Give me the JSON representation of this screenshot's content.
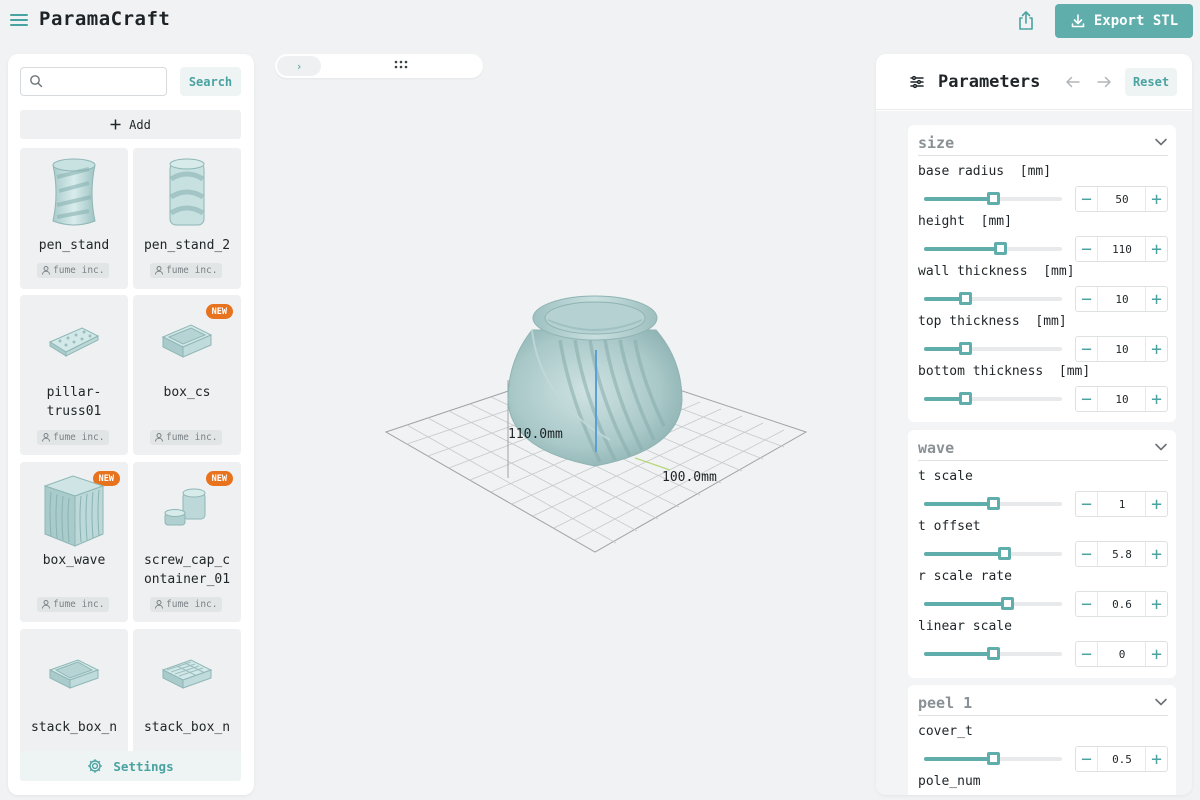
{
  "app": {
    "title": "ParamaCraft",
    "export_label": "Export STL",
    "accent_color": "#5faeab",
    "new_badge_color": "#e8731f"
  },
  "library": {
    "search_placeholder": "",
    "search_label": "Search",
    "add_label": "Add",
    "settings_label": "Settings",
    "items": [
      {
        "name": "pen_stand",
        "author": "fume inc.",
        "badge": ""
      },
      {
        "name": "pen_stand_2",
        "author": "fume inc.",
        "badge": ""
      },
      {
        "name": "pillar-\ntruss01",
        "author": "fume inc.",
        "badge": ""
      },
      {
        "name": "box_cs",
        "author": "fume inc.",
        "badge": "NEW"
      },
      {
        "name": "box_wave",
        "author": "fume inc.",
        "badge": "NEW"
      },
      {
        "name": "screw_cap_c\nontainer_01",
        "author": "fume inc.",
        "badge": "NEW"
      },
      {
        "name": "stack_box_n",
        "author": "",
        "badge": ""
      },
      {
        "name": "stack_box_n",
        "author": "",
        "badge": ""
      }
    ]
  },
  "viewport": {
    "height_label": "110.0mm",
    "width_label": "100.0mm",
    "toggle_icon": "chevron-right-icon",
    "grip_icon": "grip-icon"
  },
  "parameters": {
    "title": "Parameters",
    "reset_label": "Reset",
    "groups": [
      {
        "title": "size",
        "params": [
          {
            "label": "base radius  [mm]",
            "value": "50",
            "fraction": 0.5
          },
          {
            "label": "height  [mm]",
            "value": "110",
            "fraction": 0.55
          },
          {
            "label": "wall thickness  [mm]",
            "value": "10",
            "fraction": 0.3
          },
          {
            "label": "top thickness  [mm]",
            "value": "10",
            "fraction": 0.3
          },
          {
            "label": "bottom thickness  [mm]",
            "value": "10",
            "fraction": 0.3
          }
        ]
      },
      {
        "title": "wave",
        "params": [
          {
            "label": "t scale",
            "value": "1",
            "fraction": 0.5
          },
          {
            "label": "t offset",
            "value": "5.8",
            "fraction": 0.58
          },
          {
            "label": "r scale rate",
            "value": "0.6",
            "fraction": 0.6
          },
          {
            "label": "linear scale",
            "value": "0",
            "fraction": 0.5
          }
        ]
      },
      {
        "title": "peel 1",
        "params": [
          {
            "label": "cover_t",
            "value": "0.5",
            "fraction": 0.5
          },
          {
            "label": "pole_num",
            "value": "",
            "fraction": 0.5
          }
        ]
      }
    ]
  }
}
